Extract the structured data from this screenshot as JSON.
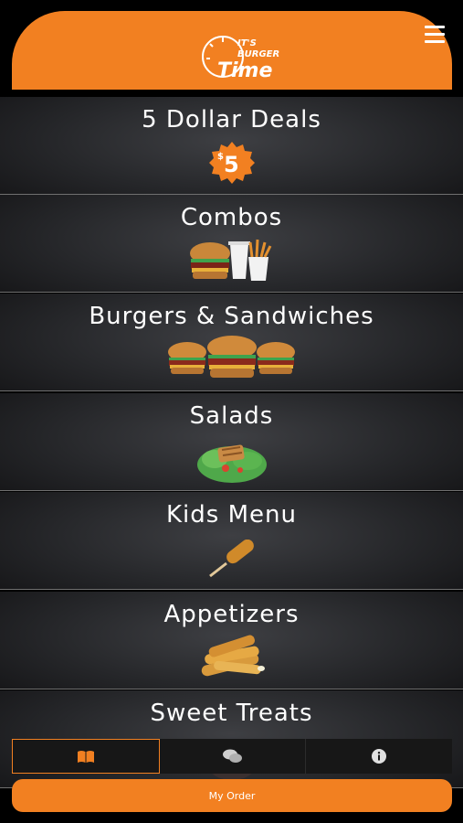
{
  "header": {
    "logo_line1": "IT'S",
    "logo_line2": "BURGER",
    "logo_line3": "Time",
    "menu_icon": "hamburger-menu-icon"
  },
  "categories": [
    {
      "label": "5 Dollar Deals",
      "badge": "$5",
      "icon": "five-dollar-badge"
    },
    {
      "label": "Combos",
      "icon": "combo-meal-image"
    },
    {
      "label": "Burgers & Sandwiches",
      "icon": "burgers-image"
    },
    {
      "label": "Salads",
      "icon": "salad-image"
    },
    {
      "label": "Kids Menu",
      "icon": "corn-dog-image"
    },
    {
      "label": "Appetizers",
      "icon": "mozzarella-sticks-image"
    },
    {
      "label": "Sweet Treats",
      "icon": "dessert-image"
    }
  ],
  "tabs": [
    {
      "icon": "book-icon",
      "active": true
    },
    {
      "icon": "chat-icon",
      "active": false
    },
    {
      "icon": "info-icon",
      "active": false
    }
  ],
  "order_button": {
    "label": "My Order"
  },
  "colors": {
    "accent": "#f28021",
    "background": "#1f2023",
    "text": "#ffffff"
  }
}
